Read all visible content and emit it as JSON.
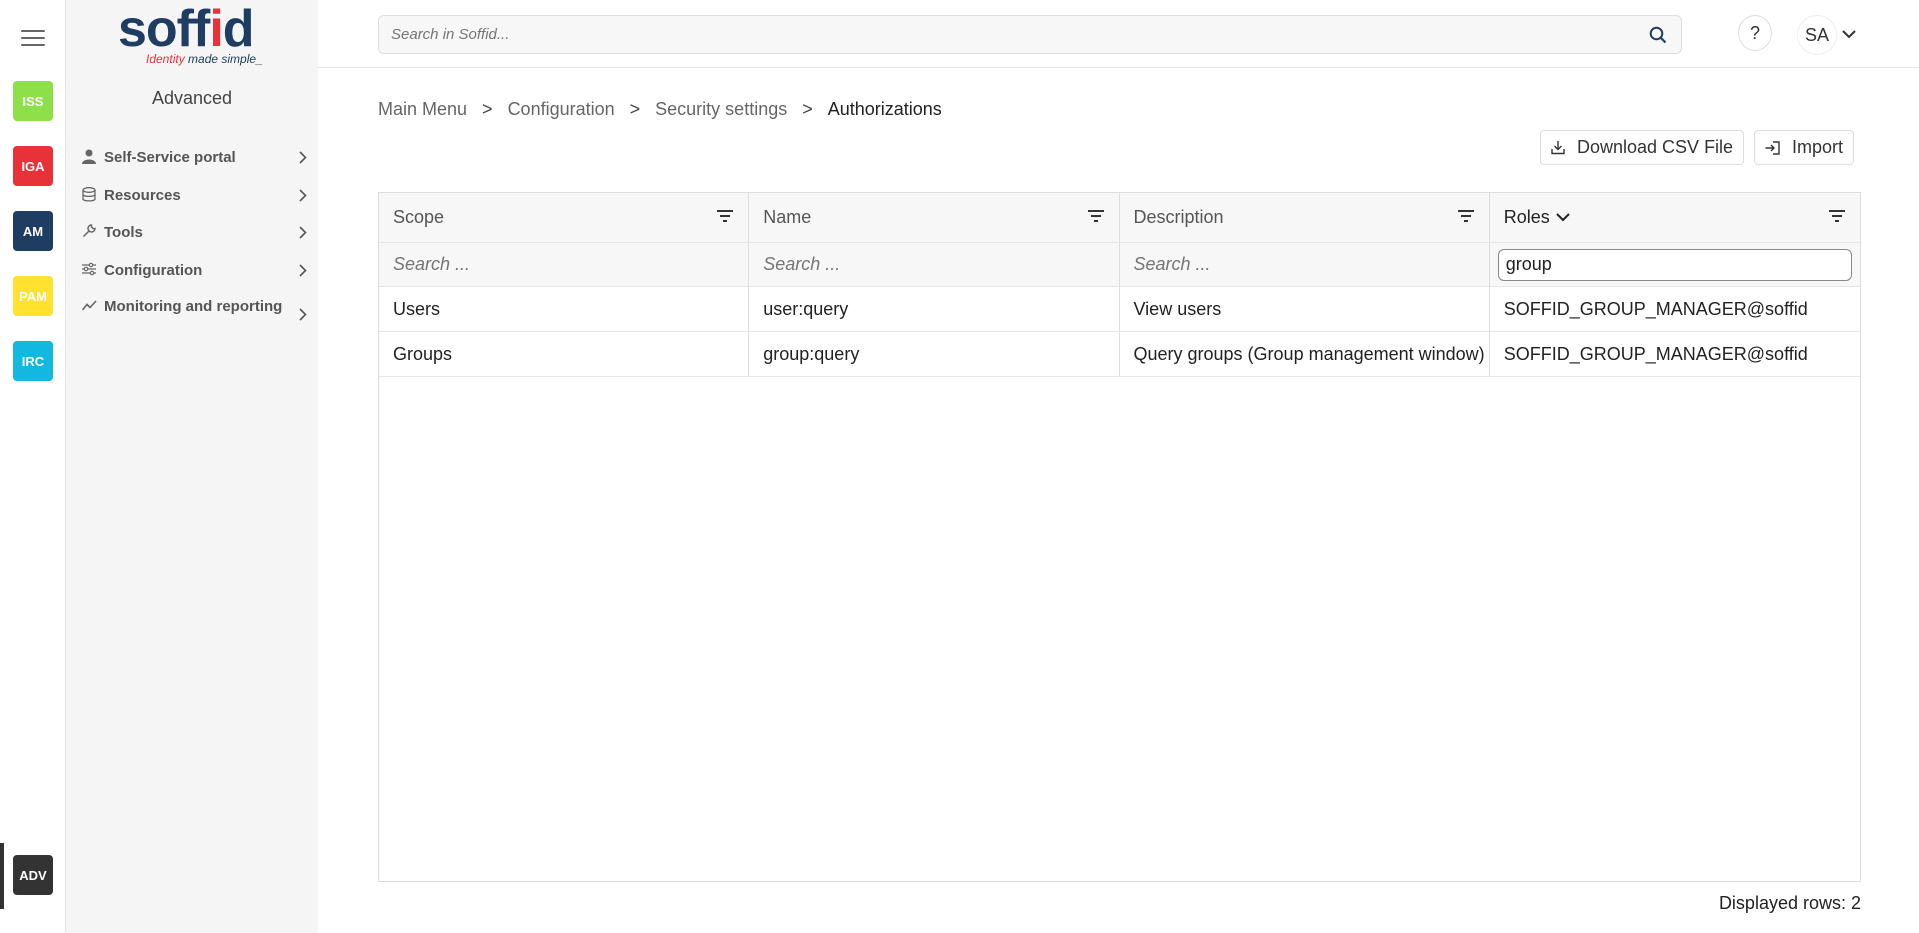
{
  "rail": {
    "apps": [
      {
        "label": "ISS",
        "color": "#8ee04a"
      },
      {
        "label": "IGA",
        "color": "#e8323a"
      },
      {
        "label": "AM",
        "color": "#1f3d63"
      },
      {
        "label": "PAM",
        "color": "#ffe12e"
      },
      {
        "label": "IRC",
        "color": "#12b8e0"
      }
    ],
    "active_app": {
      "label": "ADV",
      "color": "#333333"
    }
  },
  "sidebar": {
    "logo_text_start": "soff",
    "logo_text_red": "i",
    "logo_text_end": "d",
    "logo_tag_red": "Identity",
    "logo_tag_blue": " made simple_",
    "section_title": "Advanced",
    "items": [
      {
        "label": "Self-Service portal",
        "icon": "user-icon"
      },
      {
        "label": "Resources",
        "icon": "database-icon"
      },
      {
        "label": "Tools",
        "icon": "wrench-icon"
      },
      {
        "label": "Configuration",
        "icon": "sliders-icon"
      },
      {
        "label": "Monitoring and reporting",
        "icon": "chart-line-icon"
      }
    ]
  },
  "topbar": {
    "search_placeholder": "Search in Soffid...",
    "help_label": "?",
    "user_initials": "SA"
  },
  "breadcrumb": {
    "items": [
      "Main Menu",
      "Configuration",
      "Security settings"
    ],
    "current": "Authorizations",
    "separator": ">"
  },
  "toolbar": {
    "download_label": "Download CSV File",
    "import_label": "Import"
  },
  "table": {
    "columns": [
      "Scope",
      "Name",
      "Description",
      "Roles"
    ],
    "filter_placeholder": "Search ...",
    "roles_filter_value": "group",
    "rows": [
      {
        "scope": "Users",
        "name": "user:query",
        "description": "View users",
        "roles": "SOFFID_GROUP_MANAGER@soffid"
      },
      {
        "scope": "Groups",
        "name": "group:query",
        "description": "Query groups (Group management window)",
        "roles": "SOFFID_GROUP_MANAGER@soffid"
      }
    ],
    "displayed_rows_label": "Displayed rows: 2"
  }
}
